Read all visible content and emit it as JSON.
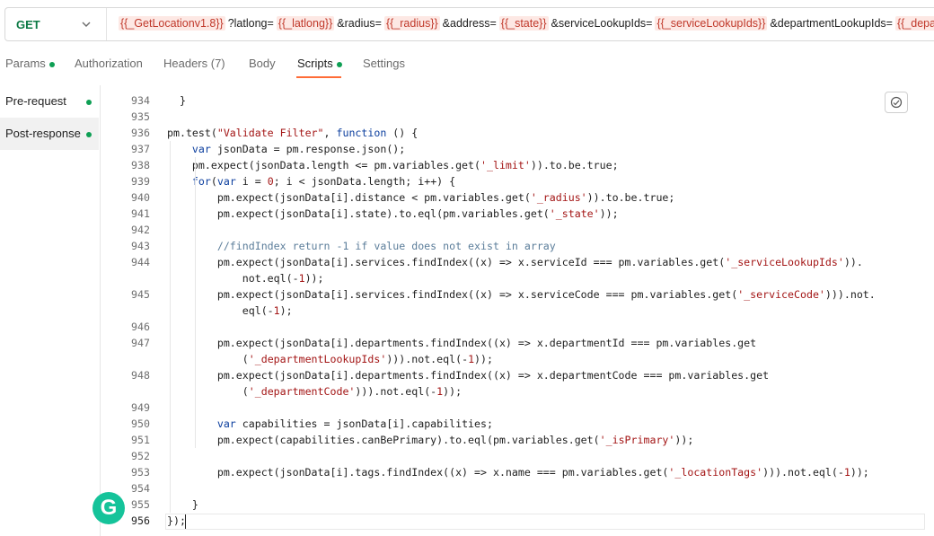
{
  "request": {
    "method": "GET",
    "url_parts": [
      {
        "t": "{{_GetLocationv1.8}}",
        "var": true
      },
      {
        "t": "?latlong=",
        "var": false
      },
      {
        "t": "{{_latlong}}",
        "var": true
      },
      {
        "t": "&radius=",
        "var": false
      },
      {
        "t": "{{_radius}}",
        "var": true
      },
      {
        "t": "&address=",
        "var": false
      },
      {
        "t": "{{_state}}",
        "var": true
      },
      {
        "t": "&serviceLookupIds=",
        "var": false
      },
      {
        "t": "{{_serviceLookupIds}}",
        "var": true
      },
      {
        "t": "&departmentLookupIds=",
        "var": false
      },
      {
        "t": "{{_departm",
        "var": true
      }
    ]
  },
  "tabs": {
    "params": "Params",
    "authorization": "Authorization",
    "headers": "Headers (7)",
    "body": "Body",
    "scripts": "Scripts",
    "settings": "Settings"
  },
  "sidebar": {
    "pre_request": "Pre-request",
    "post_response": "Post-response"
  },
  "editor": {
    "lines": [
      {
        "n": "934",
        "segs": [
          [
            "  }",
            ""
          ]
        ]
      },
      {
        "n": "935",
        "segs": []
      },
      {
        "n": "936",
        "segs": [
          [
            "pm.test(",
            ""
          ],
          [
            "\"Validate Filter\"",
            "str"
          ],
          [
            ", ",
            ""
          ],
          [
            "function",
            "kw"
          ],
          [
            " () {",
            ""
          ]
        ]
      },
      {
        "n": "937",
        "segs": [
          [
            "    ",
            ""
          ],
          [
            "var",
            "kw"
          ],
          [
            " jsonData = pm.response.json();",
            ""
          ]
        ]
      },
      {
        "n": "938",
        "segs": [
          [
            "    pm.expect(jsonData.length <= pm.variables.get(",
            ""
          ],
          [
            "'_limit'",
            "str"
          ],
          [
            ")).to.be.true;",
            ""
          ]
        ]
      },
      {
        "n": "939",
        "segs": [
          [
            "    ",
            ""
          ],
          [
            "for",
            "kw"
          ],
          [
            "(",
            ""
          ],
          [
            "var",
            "kw"
          ],
          [
            " i = ",
            ""
          ],
          [
            "0",
            "num"
          ],
          [
            "; i < jsonData.length; i++) {",
            ""
          ]
        ]
      },
      {
        "n": "940",
        "segs": [
          [
            "        pm.expect(jsonData[i].distance < pm.variables.get(",
            ""
          ],
          [
            "'_radius'",
            "str"
          ],
          [
            ")).to.be.true;",
            ""
          ]
        ]
      },
      {
        "n": "941",
        "segs": [
          [
            "        pm.expect(jsonData[i].state).to.eql(pm.variables.get(",
            ""
          ],
          [
            "'_state'",
            "str"
          ],
          [
            "));",
            ""
          ]
        ]
      },
      {
        "n": "942",
        "segs": []
      },
      {
        "n": "943",
        "segs": [
          [
            "        ",
            ""
          ],
          [
            "//findIndex return -1 if value does not exist in array",
            "cmt"
          ]
        ]
      },
      {
        "n": "944",
        "segs": [
          [
            "        pm.expect(jsonData[i].services.findIndex((x) => x.serviceId === pm.variables.get(",
            ""
          ],
          [
            "'_serviceLookupIds'",
            "str"
          ],
          [
            ")).",
            ""
          ]
        ]
      },
      {
        "n": "",
        "segs": [
          [
            "            not.eql(-",
            ""
          ],
          [
            "1",
            "num"
          ],
          [
            "));",
            ""
          ]
        ]
      },
      {
        "n": "945",
        "segs": [
          [
            "        pm.expect(jsonData[i].services.findIndex((x) => x.serviceCode === pm.variables.get(",
            ""
          ],
          [
            "'_serviceCode'",
            "str"
          ],
          [
            "))).not.",
            ""
          ]
        ]
      },
      {
        "n": "",
        "segs": [
          [
            "            eql(-",
            ""
          ],
          [
            "1",
            "num"
          ],
          [
            ");",
            ""
          ]
        ]
      },
      {
        "n": "946",
        "segs": []
      },
      {
        "n": "947",
        "segs": [
          [
            "        pm.expect(jsonData[i].departments.findIndex((x) => x.departmentId === pm.variables.get",
            ""
          ]
        ]
      },
      {
        "n": "",
        "segs": [
          [
            "            (",
            ""
          ],
          [
            "'_departmentLookupIds'",
            "str"
          ],
          [
            "))).not.eql(-",
            ""
          ],
          [
            "1",
            "num"
          ],
          [
            "));",
            ""
          ]
        ]
      },
      {
        "n": "948",
        "segs": [
          [
            "        pm.expect(jsonData[i].departments.findIndex((x) => x.departmentCode === pm.variables.get",
            ""
          ]
        ]
      },
      {
        "n": "",
        "segs": [
          [
            "            (",
            ""
          ],
          [
            "'_departmentCode'",
            "str"
          ],
          [
            "))).not.eql(-",
            ""
          ],
          [
            "1",
            "num"
          ],
          [
            "));",
            ""
          ]
        ]
      },
      {
        "n": "949",
        "segs": []
      },
      {
        "n": "950",
        "segs": [
          [
            "        ",
            ""
          ],
          [
            "var",
            "kw"
          ],
          [
            " capabilities = jsonData[i].capabilities;",
            ""
          ]
        ]
      },
      {
        "n": "951",
        "segs": [
          [
            "        pm.expect(capabilities.canBePrimary).to.eql(pm.variables.get(",
            ""
          ],
          [
            "'_isPrimary'",
            "str"
          ],
          [
            "));",
            ""
          ]
        ]
      },
      {
        "n": "952",
        "segs": []
      },
      {
        "n": "953",
        "segs": [
          [
            "        pm.expect(jsonData[i].tags.findIndex((x) => x.name === pm.variables.get(",
            ""
          ],
          [
            "'_locationTags'",
            "str"
          ],
          [
            "))).not.eql(-",
            ""
          ],
          [
            "1",
            "num"
          ],
          [
            "));",
            ""
          ]
        ]
      },
      {
        "n": "954",
        "segs": []
      },
      {
        "n": "955",
        "segs": [
          [
            "    }",
            ""
          ]
        ]
      },
      {
        "n": "956",
        "segs": [
          [
            "});",
            ""
          ]
        ]
      }
    ]
  },
  "icons": {
    "chevron": "chevron-down-icon",
    "format": "format-code-icon",
    "grammarly": "grammarly-icon"
  },
  "grammarly_letter": "G"
}
